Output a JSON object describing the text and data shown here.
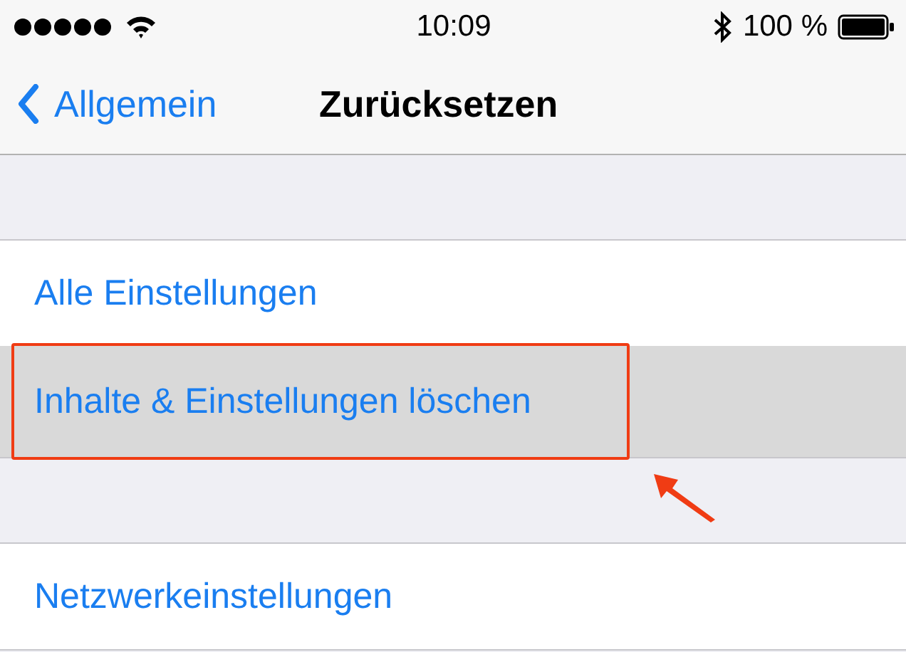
{
  "status_bar": {
    "time": "10:09",
    "battery": "100 %"
  },
  "nav_bar": {
    "back": "Allgemein",
    "title": "Zurücksetzen"
  },
  "sections": [
    {
      "items": [
        {
          "label": "Alle Einstellungen",
          "selected": false,
          "marked": false
        },
        {
          "label": "Inhalte & Einstellungen löschen",
          "selected": true,
          "marked": true
        }
      ]
    },
    {
      "items": [
        {
          "label": "Netzwerkeinstellungen",
          "selected": false,
          "marked": false
        }
      ]
    }
  ]
}
